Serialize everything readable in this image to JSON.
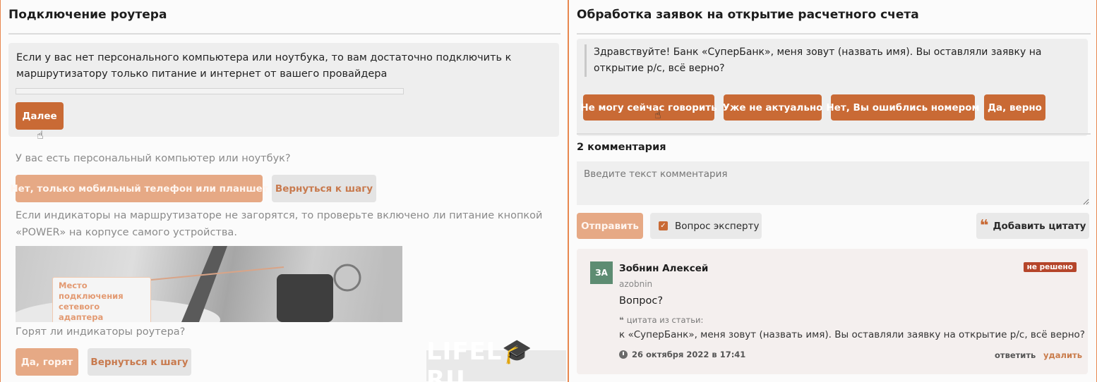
{
  "left": {
    "title": "Подключение роутера",
    "card": {
      "text": "Если у вас нет персонального компьютера или ноутбука, то вам достаточно подключить к маршрутизатору только питание и интернет от вашего провайдера",
      "next_button": "Далее"
    },
    "history": {
      "q1": "У вас есть персональный компьютер или ноутбук?",
      "q1_answer": "Нет, только мобильный телефон или планшет",
      "q1_back": "Вернуться к шагу",
      "info": "Если индикаторы на маршрутизаторе не загорятся, то проверьте включено ли питание кнопкой «POWER» на корпусе самого устройства.",
      "photo_label": "Место подключения сетевого адаптера",
      "q2": "Горят ли индикаторы роутера?",
      "q2_answer": "Да, горят",
      "q2_back": "Вернуться к шагу"
    },
    "watermark": "LIFEL🎓RU"
  },
  "right": {
    "title": "Обработка заявок на открытие расчетного счета",
    "script_text": "Здравствуйте! Банк «СуперБанк», меня зовут (назвать имя). Вы оставляли заявку на открытие р/с, всё верно?",
    "options": [
      "Не могу сейчас говорить",
      "Уже не актуально",
      "Нет, Вы ошиблись номером",
      "Да, верно"
    ],
    "comments_count": "2 комментария",
    "comment_placeholder": "Введите текст комментария",
    "send_button": "Отправить",
    "expert_checkbox": "Вопрос эксперту",
    "add_quote_button": "Добавить цитату",
    "comment": {
      "avatar": "ЗА",
      "author": "Зобнин Алексей",
      "username": "azobnin",
      "status": "не решено",
      "text": "Вопрос?",
      "quote_label": "цитата из статьи:",
      "quote": "к «СуперБанк», меня зовут (назвать имя). Вы оставляли заявку на открытие р/с, всё верно?",
      "date": "26 октября 2022 в 17:41",
      "reply": "ответить",
      "delete": "удалить"
    }
  },
  "colors": {
    "accent": "#c96a35",
    "frame": "#e8874f",
    "avatar": "#5d8c72",
    "badge": "#b5452a"
  }
}
